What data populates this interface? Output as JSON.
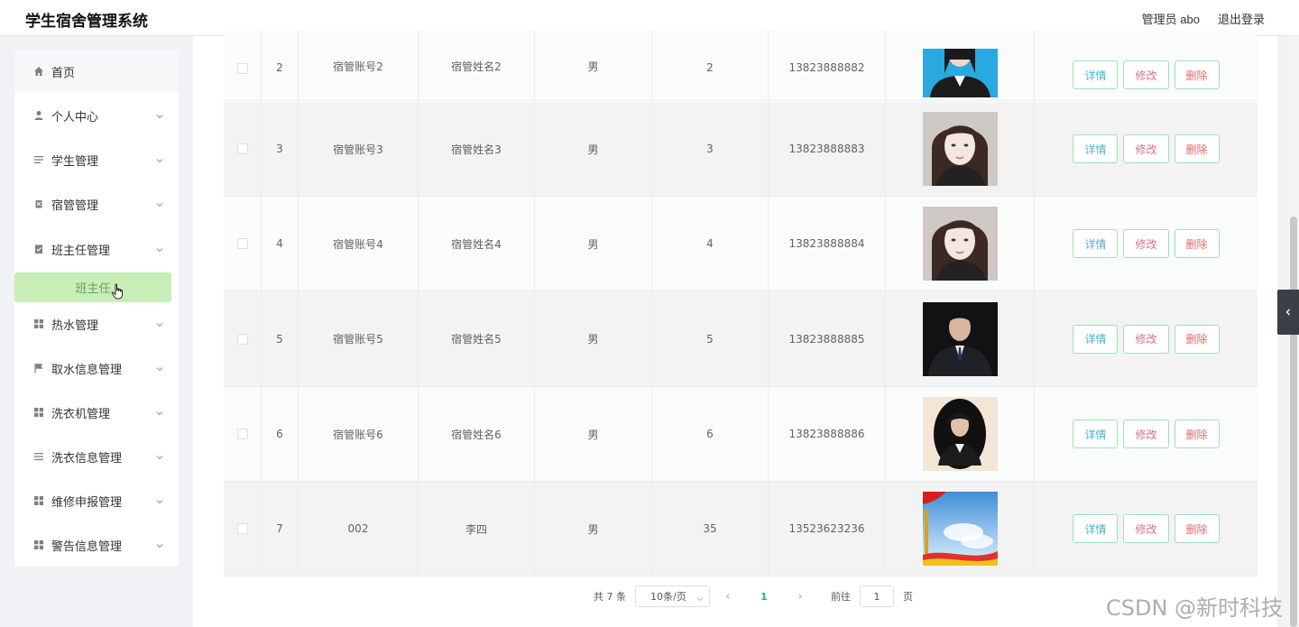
{
  "header": {
    "title": "学生宿舍管理系统",
    "user_label": "管理员 abo",
    "logout_label": "退出登录"
  },
  "sidebar": {
    "items": [
      {
        "label": "首页",
        "icon": "home-icon",
        "has_chevron": false
      },
      {
        "label": "个人中心",
        "icon": "person-icon",
        "has_chevron": true
      },
      {
        "label": "学生管理",
        "icon": "list-icon",
        "has_chevron": true
      },
      {
        "label": "宿管管理",
        "icon": "clipboard-icon",
        "has_chevron": true
      },
      {
        "label": "班主任管理",
        "icon": "clipboard-check-icon",
        "has_chevron": true
      },
      {
        "label": "热水管理",
        "icon": "grid-icon",
        "has_chevron": true
      },
      {
        "label": "取水信息管理",
        "icon": "flag-icon",
        "has_chevron": true
      },
      {
        "label": "洗衣机管理",
        "icon": "grid-icon",
        "has_chevron": true
      },
      {
        "label": "洗衣信息管理",
        "icon": "list-icon",
        "has_chevron": true
      },
      {
        "label": "维修申报管理",
        "icon": "grid-icon",
        "has_chevron": true
      },
      {
        "label": "警告信息管理",
        "icon": "grid-icon",
        "has_chevron": true
      }
    ],
    "submenu_active": "班主任"
  },
  "table": {
    "rows": [
      {
        "index": "2",
        "account": "宿管账号2",
        "name": "宿管姓名2",
        "gender": "男",
        "num": "2",
        "phone": "13823888882",
        "photo": "woman-portrait-blue-bg"
      },
      {
        "index": "3",
        "account": "宿管账号3",
        "name": "宿管姓名3",
        "gender": "男",
        "num": "3",
        "phone": "13823888883",
        "photo": "woman-portrait-selfie"
      },
      {
        "index": "4",
        "account": "宿管账号4",
        "name": "宿管姓名4",
        "gender": "男",
        "num": "4",
        "phone": "13823888884",
        "photo": "woman-portrait-selfie"
      },
      {
        "index": "5",
        "account": "宿管账号5",
        "name": "宿管姓名5",
        "gender": "男",
        "num": "5",
        "phone": "13823888885",
        "photo": "man-portrait-suit"
      },
      {
        "index": "6",
        "account": "宿管账号6",
        "name": "宿管姓名6",
        "gender": "男",
        "num": "6",
        "phone": "13823888886",
        "photo": "woman-portrait-oval"
      },
      {
        "index": "7",
        "account": "002",
        "name": "李四",
        "gender": "男",
        "num": "35",
        "phone": "13523623236",
        "photo": "sky-flag-poster"
      }
    ],
    "actions": {
      "detail": "详情",
      "edit": "修改",
      "delete": "删除"
    }
  },
  "pagination": {
    "total": "共 7 条",
    "page_size": "10条/页",
    "current_page": "1",
    "goto_label": "前往",
    "goto_value": "1",
    "page_suffix": "页"
  },
  "watermark": "CSDN @新时科技",
  "colors": {
    "accent": "#19b38d",
    "submenu_bg": "#c8eeb8",
    "button_border": "#9fdfb9"
  }
}
